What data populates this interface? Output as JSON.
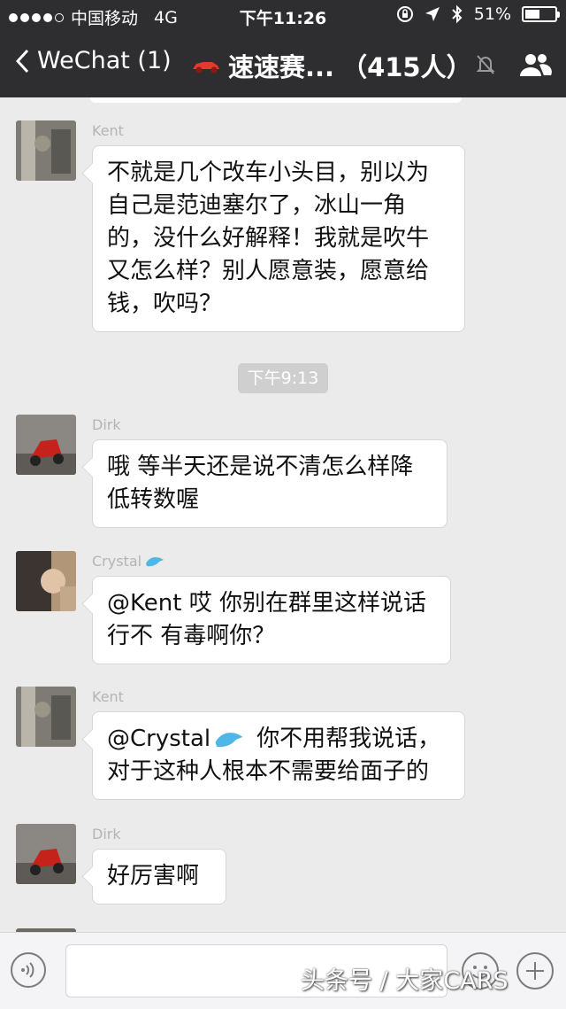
{
  "status_bar": {
    "carrier": "中国移动",
    "network": "4G",
    "time": "下午11:26",
    "battery": "51%",
    "battery_level": 0.51
  },
  "nav": {
    "back_label": "WeChat (1)",
    "group_name": "速速赛...",
    "member_count": "（415人）"
  },
  "messages": [
    {
      "sender": "Kent",
      "lines": [
        "不就是几个改车小头目，别以为",
        "自己是范迪塞尔了，冰山一角",
        "的，没什么好解释！我就是吹牛",
        "又怎么样？别人愿意装，愿意给",
        "钱，吹吗？"
      ]
    },
    {
      "sender": "Dirk",
      "lines": [
        "哦 等半天还是说不清怎么样降",
        "低转数喔"
      ]
    },
    {
      "sender": "Crystal",
      "lines": [
        "@Kent 哎 你别在群里这样说话",
        "行不 有毒啊你？"
      ]
    },
    {
      "sender": "Kent",
      "lines": [
        "@Crystal",
        "你不用帮我说话，",
        "对于这种人根本不需要给面子的"
      ]
    },
    {
      "sender": "Dirk",
      "lines": [
        "好厉害啊"
      ]
    }
  ],
  "timestamp": "下午9:13",
  "watermark": "头条号 / 大家CARS",
  "icons": {
    "back": "chevron-left-icon",
    "car": "red-car-icon",
    "mute": "mute-bell-icon",
    "group": "group-members-icon",
    "dolphin": "dolphin-emoji",
    "voice": "voice-icon",
    "emoji": "emoji-icon",
    "plus": "plus-icon"
  },
  "colors": {
    "header": "#2e2e30",
    "chat_bg": "#ebebeb",
    "bubble": "#ffffff",
    "timestamp_bg": "#cfcfcf"
  }
}
